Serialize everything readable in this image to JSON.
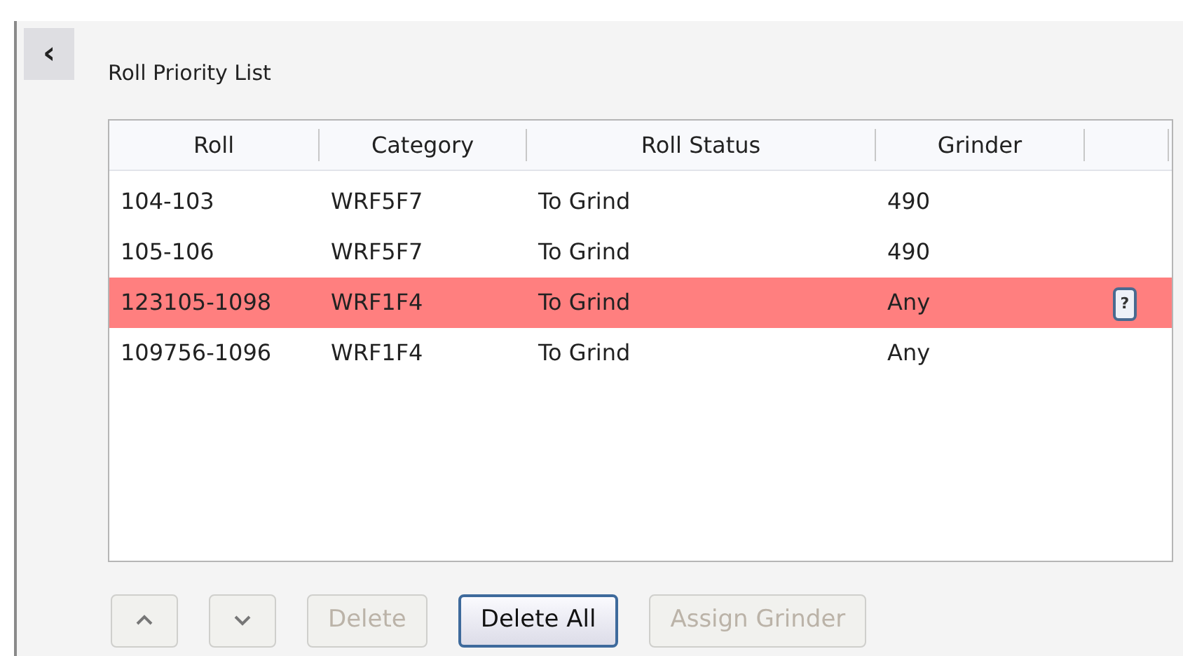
{
  "collapse_button": "‹",
  "title": "Roll Priority List",
  "table": {
    "columns": [
      "Roll",
      "Category",
      "Roll Status",
      "Grinder"
    ],
    "rows": [
      {
        "cells": [
          "104-103",
          "WRF5F7",
          "To Grind",
          "490"
        ],
        "selected": false
      },
      {
        "cells": [
          "105-106",
          "WRF5F7",
          "To Grind",
          "490"
        ],
        "selected": false
      },
      {
        "cells": [
          "123105-1098",
          "WRF1F4",
          "To Grind",
          "Any"
        ],
        "selected": true,
        "help_button": "?"
      },
      {
        "cells": [
          "109756-1096",
          "WRF1F4",
          "To Grind",
          "Any"
        ],
        "selected": false
      }
    ]
  },
  "buttons": [
    {
      "kind": "up",
      "disabled": true
    },
    {
      "kind": "down",
      "disabled": true
    },
    {
      "kind": "text",
      "label": "Delete",
      "disabled": true
    },
    {
      "kind": "text",
      "label": "Delete All",
      "disabled": false
    },
    {
      "kind": "text",
      "label": "Assign Grinder",
      "disabled": true
    }
  ]
}
